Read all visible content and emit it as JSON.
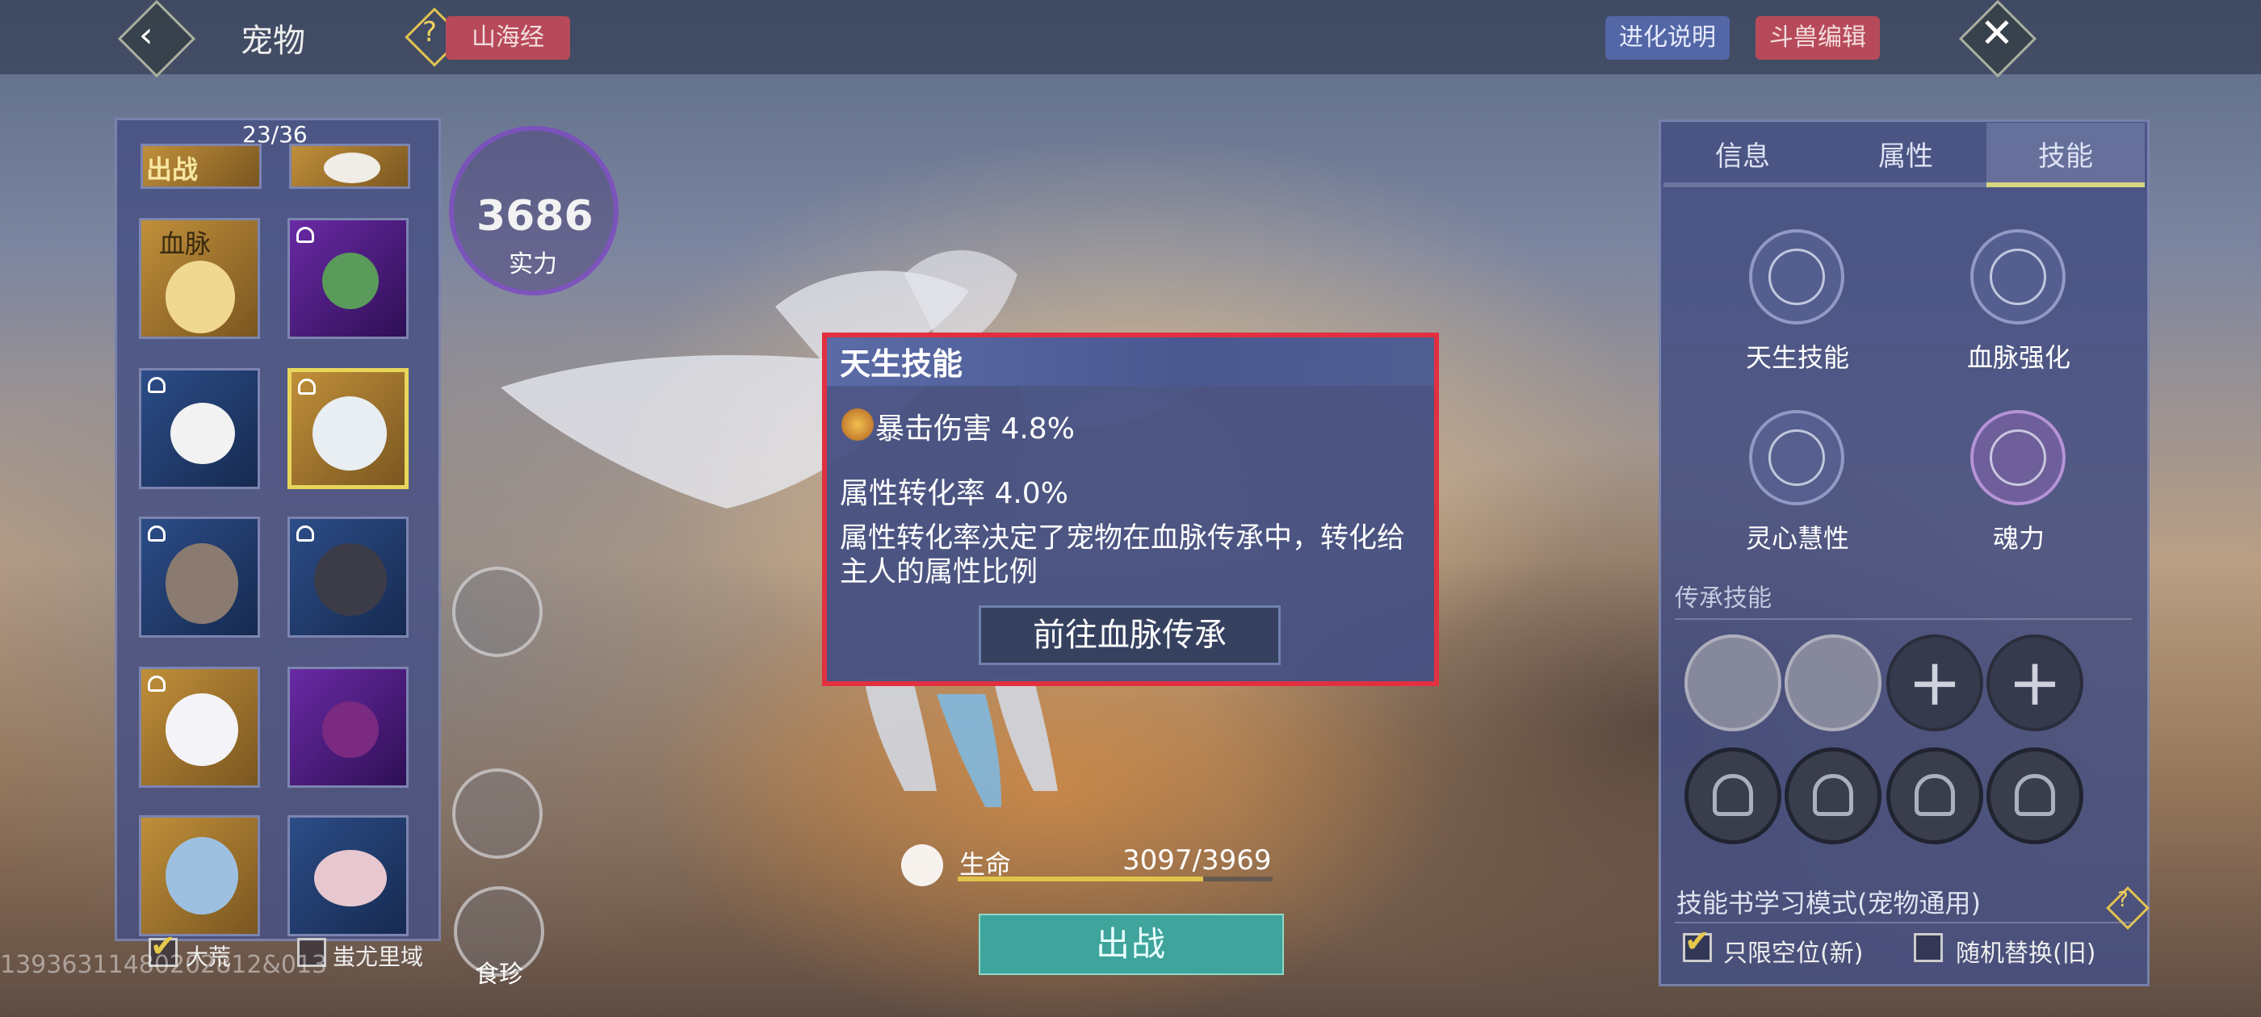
{
  "header": {
    "title": "宠物",
    "shanhai_label": "山海经",
    "evolution_label": "进化说明",
    "beast_edit_label": "斗兽编辑"
  },
  "left_panel": {
    "count": "23/36",
    "tile_labels": {
      "battle": "出战",
      "bloodline": "血脉"
    },
    "filters": [
      {
        "label": "大荒",
        "checked": true
      },
      {
        "label": "蚩尤里域",
        "checked": false
      }
    ]
  },
  "power": {
    "value": "3686",
    "label": "实力"
  },
  "side_buttons": {
    "shizhen_label": "食珍"
  },
  "hp": {
    "label": "生命",
    "value": "3097/3969",
    "fraction": 0.78
  },
  "fight_button": "出战",
  "watermark": "13936311480202812&013",
  "popup": {
    "title": "天生技能",
    "crit": "暴击伤害 4.8%",
    "conversion": "属性转化率 4.0%",
    "description": "属性转化率决定了宠物在血脉传承中，转化给主人的属性比例",
    "button": "前往血脉传承"
  },
  "right_panel": {
    "tabs": [
      "信息",
      "属性",
      "技能"
    ],
    "active_tab": "技能",
    "skills": [
      "天生技能",
      "血脉强化",
      "灵心慧性",
      "魂力"
    ],
    "inherit_label": "传承技能",
    "book_mode_label": "技能书学习模式(宠物通用)",
    "options": [
      {
        "label": "只限空位(新)",
        "checked": true
      },
      {
        "label": "随机替换(旧)",
        "checked": false
      }
    ]
  },
  "colors": {
    "accent_gold": "#e0c34a",
    "highlight_red": "#e23040",
    "teal_button": "#3ea49c"
  }
}
